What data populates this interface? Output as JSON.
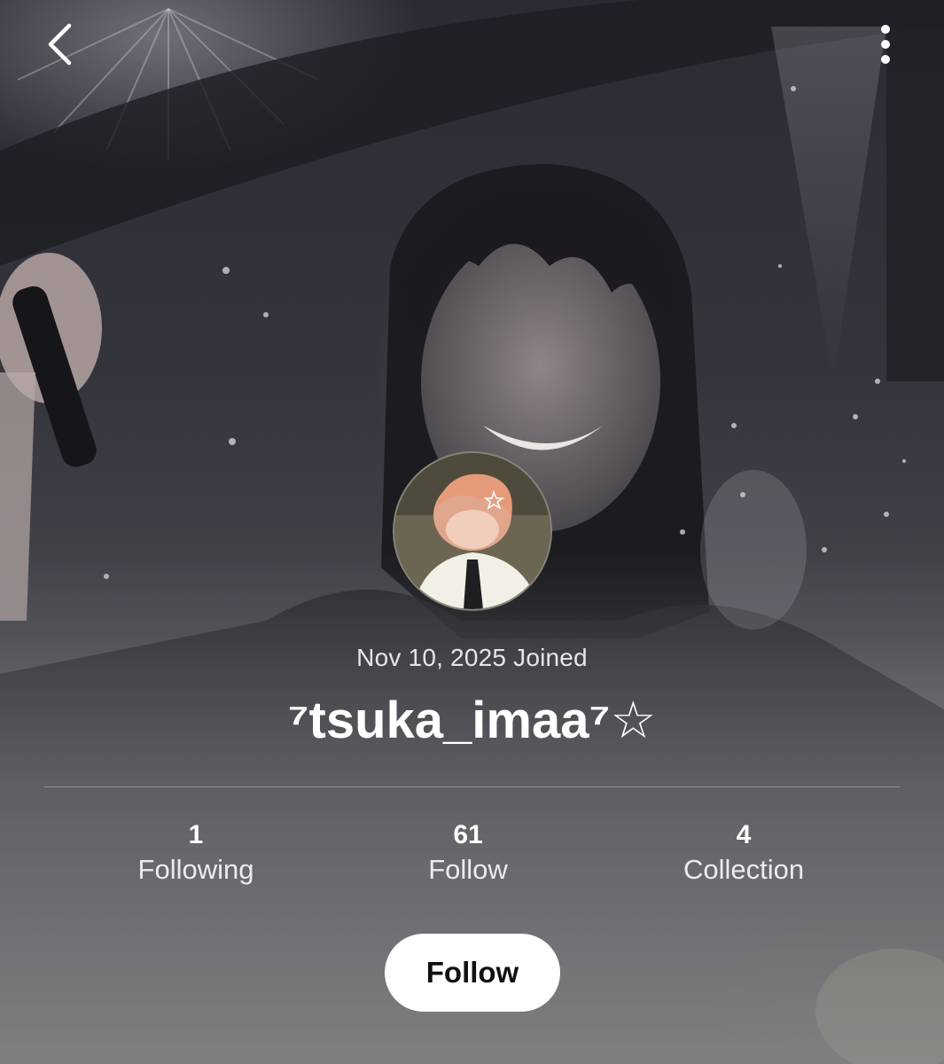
{
  "header": {
    "back_icon": "chevron-left-icon",
    "more_icon": "more-vertical-icon"
  },
  "profile": {
    "joined_text": "Nov 10, 2025 Joined",
    "username": "⁷tsuka_imaa⁷☆"
  },
  "stats": [
    {
      "value": "1",
      "label": "Following"
    },
    {
      "value": "61",
      "label": "Follow"
    },
    {
      "value": "4",
      "label": "Collection"
    }
  ],
  "actions": {
    "follow_label": "Follow"
  }
}
